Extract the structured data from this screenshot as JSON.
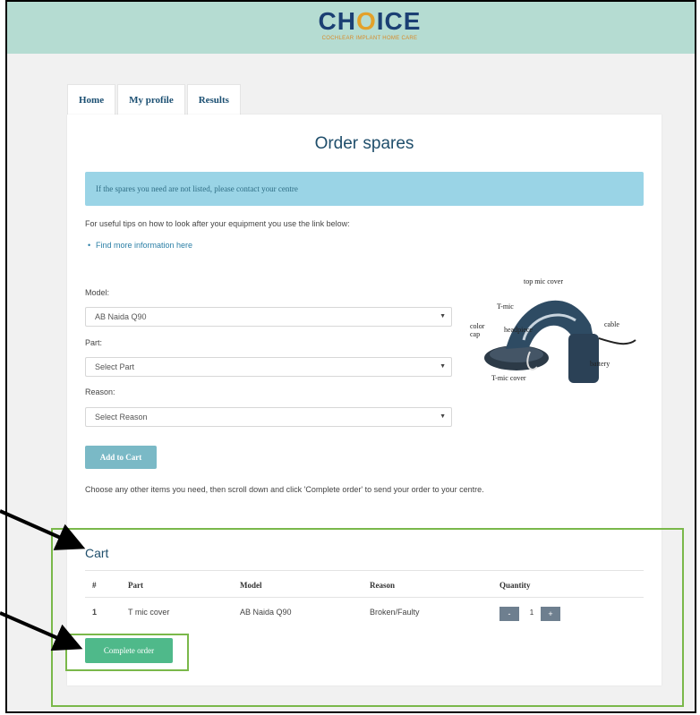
{
  "brand": {
    "logo_text_pre": "CH",
    "logo_text_o": "O",
    "logo_text_post": "ICE",
    "tagline": "COCHLEAR IMPLANT HOME CARE"
  },
  "tabs": [
    {
      "label": "Home"
    },
    {
      "label": "My profile"
    },
    {
      "label": "Results"
    }
  ],
  "page": {
    "title": "Order spares",
    "alert": "If the spares you need are not listed, please contact your centre",
    "tips_text": "For useful tips on how to look after your equipment you use the link below:",
    "tips_link": "Find more information here",
    "bullet": "•"
  },
  "form": {
    "model_label": "Model:",
    "model_value": "AB Naida Q90",
    "part_label": "Part:",
    "part_value": "Select Part",
    "reason_label": "Reason:",
    "reason_value": "Select Reason",
    "caret": "▼",
    "add_button": "Add to Cart",
    "choose_text": "Choose any other items you need, then scroll down and click 'Complete order' to send your order to your centre."
  },
  "device_labels": {
    "top_mic_cover": "top mic cover",
    "t_mic": "T-mic",
    "color_cap": "color cap",
    "headpiece": "headpiece",
    "cable": "cable",
    "battery": "battery",
    "t_mic_cover": "T-mic cover"
  },
  "cart": {
    "title": "Cart",
    "columns": [
      "#",
      "Part",
      "Model",
      "Reason",
      "Quantity"
    ],
    "rows": [
      {
        "num": "1",
        "part": "T mic cover",
        "model": "AB Naida Q90",
        "reason": "Broken/Faulty",
        "quantity": "1"
      }
    ],
    "minus": "-",
    "plus": "+",
    "complete_button": "Complete order"
  },
  "colors": {
    "header_bg": "#b5dcd2",
    "brand_navy": "#1b3f73",
    "alert_bg": "#9ad4e6",
    "annotation_green": "#7ab84a",
    "complete_button": "#4fb98a"
  }
}
